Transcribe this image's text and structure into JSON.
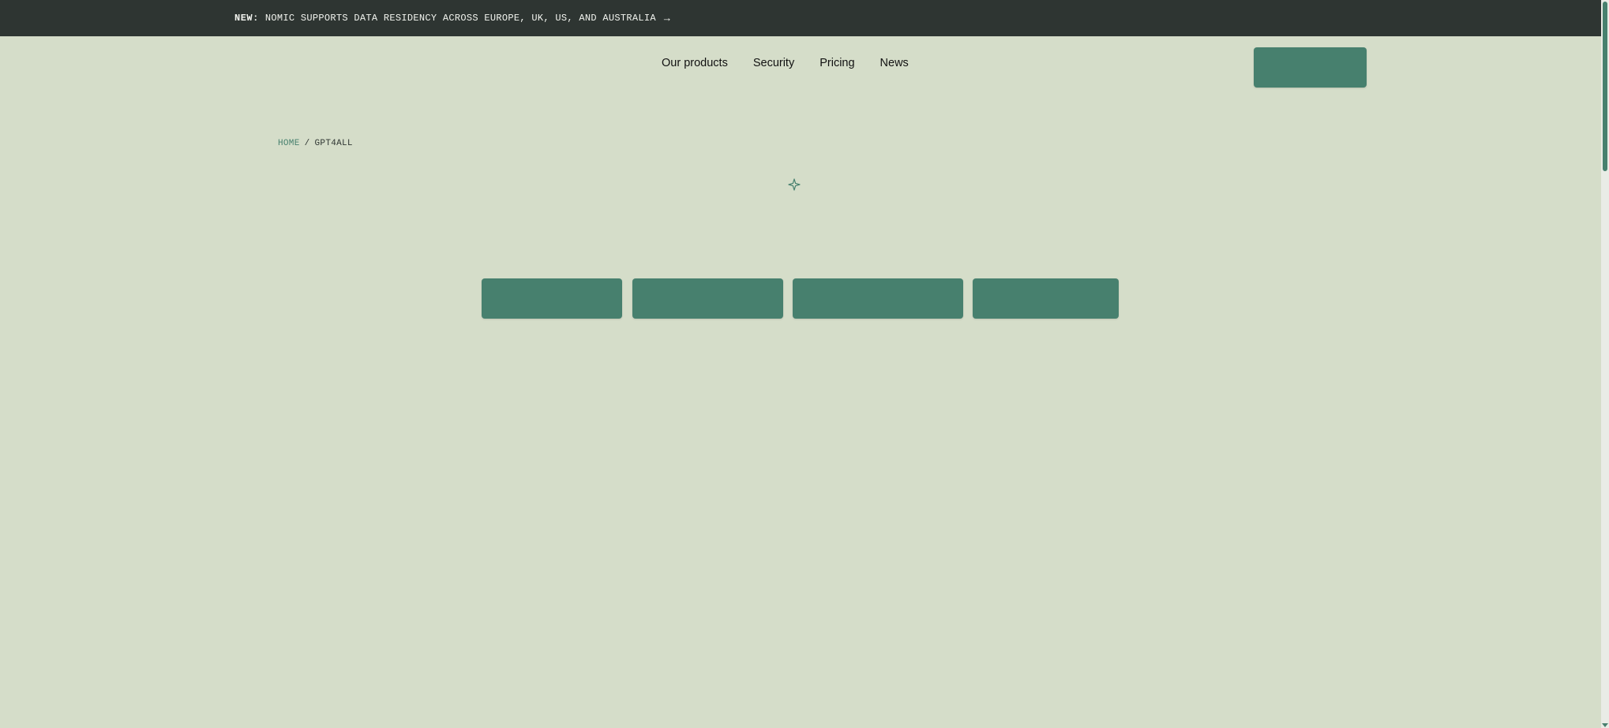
{
  "announcement": {
    "tag": "NEW:",
    "text": "NOMIC SUPPORTS DATA RESIDENCY ACROSS EUROPE, UK, US, AND AUSTRALIA",
    "arrow": "→"
  },
  "nav": {
    "items": [
      {
        "label": "Our products"
      },
      {
        "label": "Security"
      },
      {
        "label": "Pricing"
      },
      {
        "label": "News"
      }
    ]
  },
  "breadcrumb": {
    "home": "HOME",
    "separator": "/",
    "current": "GPT4ALL"
  },
  "icons": {
    "sparkle": "sparkle-icon",
    "arrow": "arrow-right-icon"
  },
  "colors": {
    "background": "#d5ddc9",
    "banner": "#2e3532",
    "accent": "#47806e"
  }
}
